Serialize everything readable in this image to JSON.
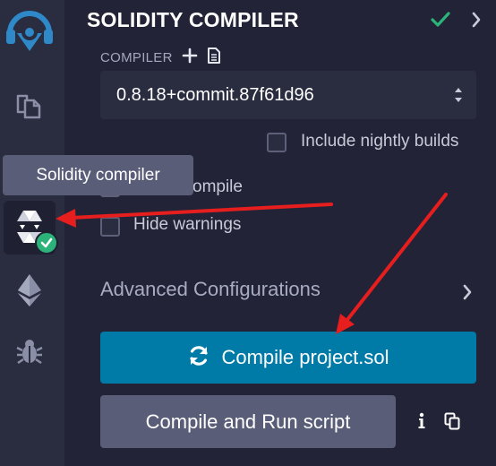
{
  "sidebar": {
    "icons": [
      {
        "name": "remix-logo-icon"
      },
      {
        "name": "file-explorer-icon"
      },
      {
        "name": "solidity-compiler-icon",
        "active": true,
        "badge": "check-badge-icon"
      },
      {
        "name": "deploy-run-icon"
      },
      {
        "name": "debugger-icon"
      }
    ],
    "tooltip": "Solidity compiler"
  },
  "panel": {
    "title": "SOLIDITY COMPILER",
    "compiler_label": "COMPILER",
    "compiler_version": "0.8.18+commit.87f61d96",
    "include_nightly_label": "Include nightly builds",
    "auto_compile_label": "ompile",
    "hide_warnings_label": "Hide warnings",
    "advanced_label": "Advanced Configurations",
    "compile_button_label": "Compile project.sol",
    "compile_run_button_label": "Compile and Run script"
  },
  "colors": {
    "background": "#222336",
    "rail": "#2a2c3f",
    "accent_blue": "#007aa6",
    "secondary_button": "#595d78",
    "success_green": "#2bb37a",
    "annotation_red": "#e61e1e"
  }
}
